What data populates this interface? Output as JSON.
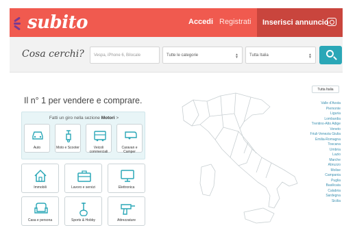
{
  "header": {
    "logo_text": "subito",
    "login_label": "Accedi",
    "register_label": "Registrati",
    "post_ad_label": "Inserisci annuncio",
    "brand_color": "#f05a4f"
  },
  "search": {
    "title": "Cosa cerchi?",
    "placeholder": "Vespa, iPhone 6, Bilocale",
    "category_value": "Tutte le categorie",
    "region_value": "Tutta Italia",
    "button_color": "#2aa7b7"
  },
  "hero": {
    "tagline": "Il n° 1 per vendere e comprare."
  },
  "motori": {
    "intro": "Fatti un giro nella sezione",
    "section": "Motori",
    "arrow": ">",
    "items": [
      {
        "label": "Auto",
        "icon": "car-icon"
      },
      {
        "label": "Moto e Scooter",
        "icon": "scooter-icon"
      },
      {
        "label": "Veicoli commerciali",
        "icon": "van-icon"
      },
      {
        "label": "Caravan e Camper",
        "icon": "caravan-icon"
      }
    ]
  },
  "categories": [
    {
      "label": "Immobili",
      "icon": "house-icon"
    },
    {
      "label": "Lavoro e servizi",
      "icon": "briefcase-icon"
    },
    {
      "label": "Elettronica",
      "icon": "monitor-icon"
    },
    {
      "label": "Casa e persona",
      "icon": "armchair-icon"
    },
    {
      "label": "Sports & Hobby",
      "icon": "guitar-icon"
    },
    {
      "label": "Attrezzature",
      "icon": "drill-icon"
    }
  ],
  "map": {
    "all_italy_button": "Tutta Italia",
    "regions": [
      "Valle d'Aosta",
      "Piemonte",
      "Liguria",
      "Lombardia",
      "Trentino-Alto Adige",
      "Veneto",
      "Friuli-Venezia Giulia",
      "Emilia-Romagna",
      "Toscana",
      "Umbria",
      "Lazio",
      "Marche",
      "Abruzzo",
      "Molise",
      "Campania",
      "Puglia",
      "Basilicata",
      "Calabria",
      "Sardegna",
      "Sicilia"
    ],
    "link_color": "#3a8fb0"
  }
}
